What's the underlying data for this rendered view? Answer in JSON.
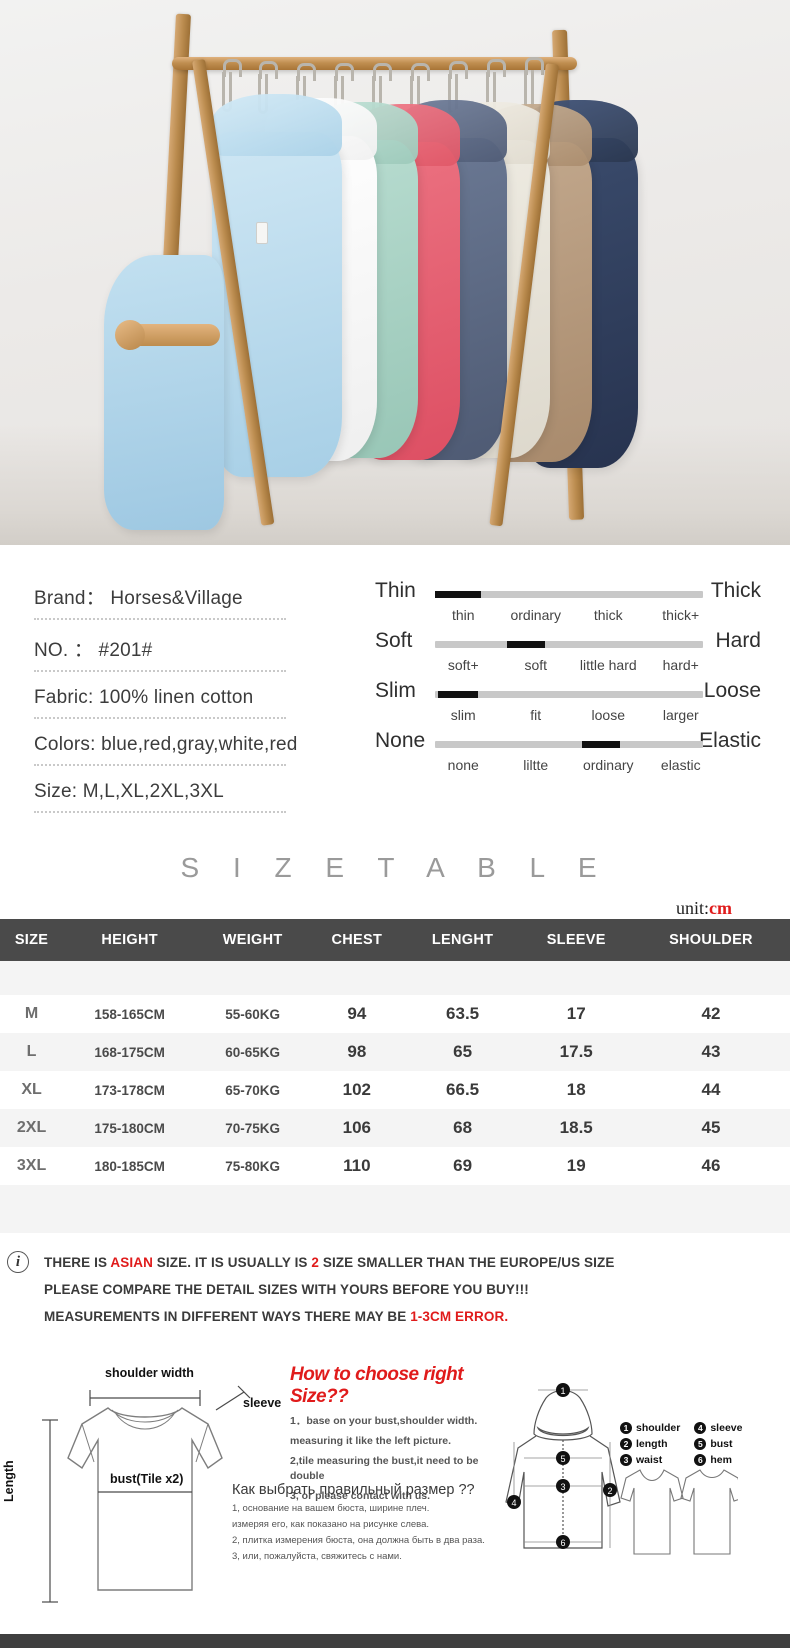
{
  "hero": {
    "alt": "linen cotton hoodies hanging on wooden clothes rack",
    "garment_colors": [
      "#b6d7ea",
      "#a9d2e8",
      "#ffffff",
      "#aad3c6",
      "#e8697a",
      "#5d6b86",
      "#e8e6df",
      "#b39a84",
      "#2f3f5e"
    ]
  },
  "specs": {
    "rows": [
      {
        "label": "Brand：",
        "value": "Horses&Village"
      },
      {
        "label": "NO.  ：",
        "value": "#201#"
      },
      {
        "label": "Fabric:",
        "value": "100% linen cotton"
      },
      {
        "label": "Colors:",
        "value": "blue,red,gray,white,red"
      },
      {
        "label": "Size:",
        "value": " M,L,XL,2XL,3XL"
      }
    ]
  },
  "ratings": [
    {
      "left": "Thin",
      "right": "Thick",
      "ticks": [
        "thin",
        "ordinary",
        "thick",
        "thick+"
      ],
      "selected": 0,
      "fill_start_pct": 0,
      "fill_width_pct": 17
    },
    {
      "left": "Soft",
      "right": "Hard",
      "ticks": [
        "soft+",
        "soft",
        "little hard",
        "hard+"
      ],
      "selected": 1,
      "fill_start_pct": 27,
      "fill_width_pct": 14
    },
    {
      "left": "Slim",
      "right": "Loose",
      "ticks": [
        "slim",
        "fit",
        "loose",
        "larger"
      ],
      "selected": 0,
      "fill_start_pct": 1,
      "fill_width_pct": 15
    },
    {
      "left": "None",
      "right": "Elastic",
      "ticks": [
        "none",
        "liltte",
        "ordinary",
        "elastic"
      ],
      "selected": 2,
      "fill_start_pct": 55,
      "fill_width_pct": 14
    }
  ],
  "size_table": {
    "title": "S I Z E   T A B L E",
    "unit_label": "unit:",
    "unit_value": "cm",
    "headers": [
      "SIZE",
      "HEIGHT",
      "WEIGHT",
      "CHEST",
      "LENGHT",
      "SLEEVE",
      "SHOULDER"
    ],
    "rows": [
      [
        "M",
        "158-165CM",
        "55-60KG",
        "94",
        "63.5",
        "17",
        "42"
      ],
      [
        "L",
        "168-175CM",
        "60-65KG",
        "98",
        "65",
        "17.5",
        "43"
      ],
      [
        "XL",
        "173-178CM",
        "65-70KG",
        "102",
        "66.5",
        "18",
        "44"
      ],
      [
        "2XL",
        "175-180CM",
        "70-75KG",
        "106",
        "68",
        "18.5",
        "45"
      ],
      [
        "3XL",
        "180-185CM",
        "75-80KG",
        "110",
        "69",
        "19",
        "46"
      ]
    ]
  },
  "notice": {
    "icon": "info-icon",
    "line1_a": "THERE IS ",
    "line1_highlight1": "ASIAN",
    "line1_b": " SIZE. IT IS USUALLY IS ",
    "line1_highlight2": "2",
    "line1_c": " SIZE SMALLER THAN THE EUROPE/US SIZE",
    "line2": "PLEASE COMPARE THE DETAIL SIZES WITH YOURS BEFORE YOU BUY!!!",
    "line3_a": "MEASUREMENTS IN DIFFERENT WAYS THERE MAY BE ",
    "line3_highlight": "1-3CM ERROR."
  },
  "diagram": {
    "shoulder_width_label": "shoulder width",
    "bust_label": "bust(Tile  x2)",
    "length_label": "Length",
    "sleeve_label": "sleeve",
    "howto_title": "How to choose right Size??",
    "howto_lines": [
      "1．base on your bust,shoulder width.",
      "measuring it like the left picture.",
      "2,tile measuring the bust,it need to be double",
      "3, or please contact with us."
    ],
    "ru_title": "Как выбрать правильный размер ??",
    "ru_lines": [
      "1, основание на вашем бюста, ширине плеч.",
      "измеряя его, как показано на рисунке слева.",
      "2, плитка измерения бюста, она должна быть в два раза.",
      "3, или, пожалуйста, свяжитесь с нами."
    ],
    "legend": [
      {
        "num": "1",
        "label": "shoulder"
      },
      {
        "num": "4",
        "label": "sleeve"
      },
      {
        "num": "2",
        "label": "length"
      },
      {
        "num": "5",
        "label": "bust"
      },
      {
        "num": "3",
        "label": "waist"
      },
      {
        "num": "6",
        "label": "hem"
      }
    ]
  },
  "colors": {
    "accent_red": "#e01b1b",
    "header_bg": "#4a4a4a",
    "row_alt": "#f4f4f4"
  }
}
